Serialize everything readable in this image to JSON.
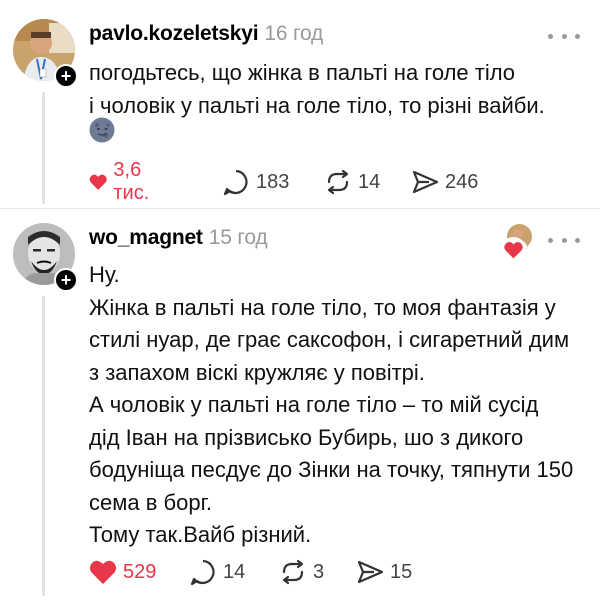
{
  "posts": [
    {
      "username": "pavlo.kozeletskyi",
      "time": "16 год",
      "lines": [
        "погодьтесь, що жінка в пальті на голе тіло",
        "і чоловік у пальті на голе тіло, то різні вайби."
      ],
      "emoji": "new-moon-face-emoji",
      "likes": "3,6 тис.",
      "comments": "183",
      "reposts": "14",
      "shares": "246",
      "liked": true
    },
    {
      "username": "wo_magnet",
      "time": "15 год",
      "lines": [
        "Ну.",
        "Жінка в пальті на голе тіло, то моя фантазія у",
        "стилі нуар, де грає саксофон, і сигаретний дим",
        "з запахом віскі кружляє у повітрі.",
        "А чоловік у пальті на голе тіло – то мій сусід",
        "дід Іван на прізвисько Бубирь, шо з дикого",
        "бодуніща песдує до Зінки на точку, тяпнути 150",
        "сема в борг.",
        "Тому так.Вайб різний."
      ],
      "likes": "529",
      "comments": "14",
      "reposts": "3",
      "shares": "15",
      "liked": true
    }
  ],
  "icons": {
    "like": "heart-icon",
    "comment": "comment-icon",
    "repost": "repost-icon",
    "share": "share-icon",
    "more": "more-icon",
    "follow": "plus-icon"
  },
  "colors": {
    "like": "#e8374a",
    "muted": "#9a9a9a",
    "text": "#111111"
  }
}
